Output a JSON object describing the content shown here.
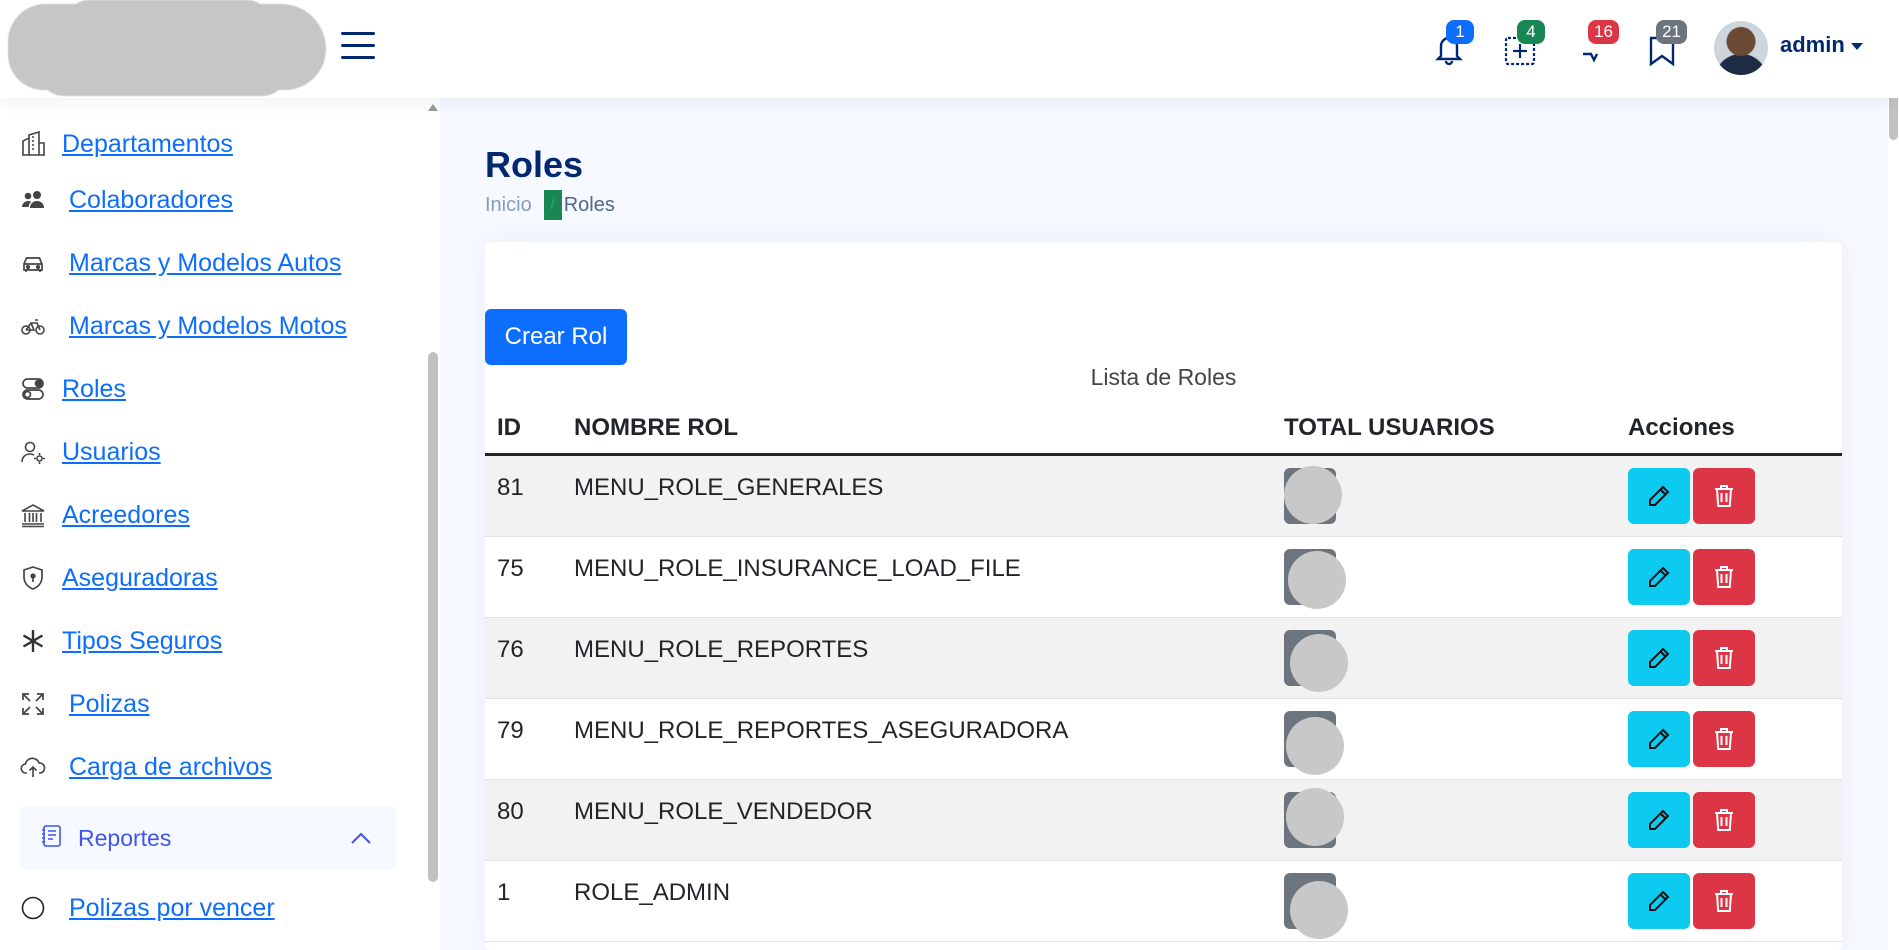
{
  "header": {
    "notifications": [
      {
        "icon": "bell-icon",
        "count": "1",
        "color": "#0d6efd"
      },
      {
        "icon": "add-square-icon",
        "count": "4",
        "color": "#198754"
      },
      {
        "icon": "chat-icon",
        "count": "16",
        "color": "#dc3545"
      },
      {
        "icon": "bookmark-icon",
        "count": "21",
        "color": "#6c757d"
      }
    ],
    "user_name": "admin"
  },
  "sidebar": {
    "items": [
      {
        "label": "Departamentos",
        "icon": "buildings-icon"
      },
      {
        "label": "Colaboradores",
        "icon": "people-icon"
      },
      {
        "label": "Marcas y Modelos Autos",
        "icon": "car-icon"
      },
      {
        "label": "Marcas y Modelos Motos",
        "icon": "bicycle-icon"
      },
      {
        "label": "Roles",
        "icon": "toggles-icon"
      },
      {
        "label": "Usuarios",
        "icon": "person-gear-icon"
      },
      {
        "label": "Acreedores",
        "icon": "bank-icon"
      },
      {
        "label": "Aseguradoras",
        "icon": "shield-icon"
      },
      {
        "label": "Tipos Seguros",
        "icon": "asterisk-icon"
      },
      {
        "label": "Polizas",
        "icon": "fullscreen-icon"
      },
      {
        "label": "Carga de archivos",
        "icon": "cloud-upload-icon"
      }
    ],
    "group": {
      "label": "Reportes",
      "icon": "journal-text-icon"
    },
    "subitems": [
      {
        "label": "Polizas por vencer",
        "icon": "circle-icon"
      }
    ]
  },
  "main": {
    "title": "Roles",
    "breadcrumb": {
      "home": "Inicio",
      "separator": "/",
      "current": "Roles"
    },
    "create_button": "Crear Rol",
    "table_caption": "Lista de Roles",
    "columns": [
      "ID",
      "NOMBRE ROL",
      "TOTAL USUARIOS",
      "Acciones"
    ],
    "rows": [
      {
        "id": "81",
        "name": "MENU_ROLE_GENERALES"
      },
      {
        "id": "75",
        "name": "MENU_ROLE_INSURANCE_LOAD_FILE"
      },
      {
        "id": "76",
        "name": "MENU_ROLE_REPORTES"
      },
      {
        "id": "79",
        "name": "MENU_ROLE_REPORTES_ASEGURADORA"
      },
      {
        "id": "80",
        "name": "MENU_ROLE_VENDEDOR"
      },
      {
        "id": "1",
        "name": "ROLE_ADMIN"
      }
    ]
  },
  "colors": {
    "primary": "#0d6efd",
    "info": "#0dcaf0",
    "danger": "#dc3545",
    "navy": "#012970"
  }
}
